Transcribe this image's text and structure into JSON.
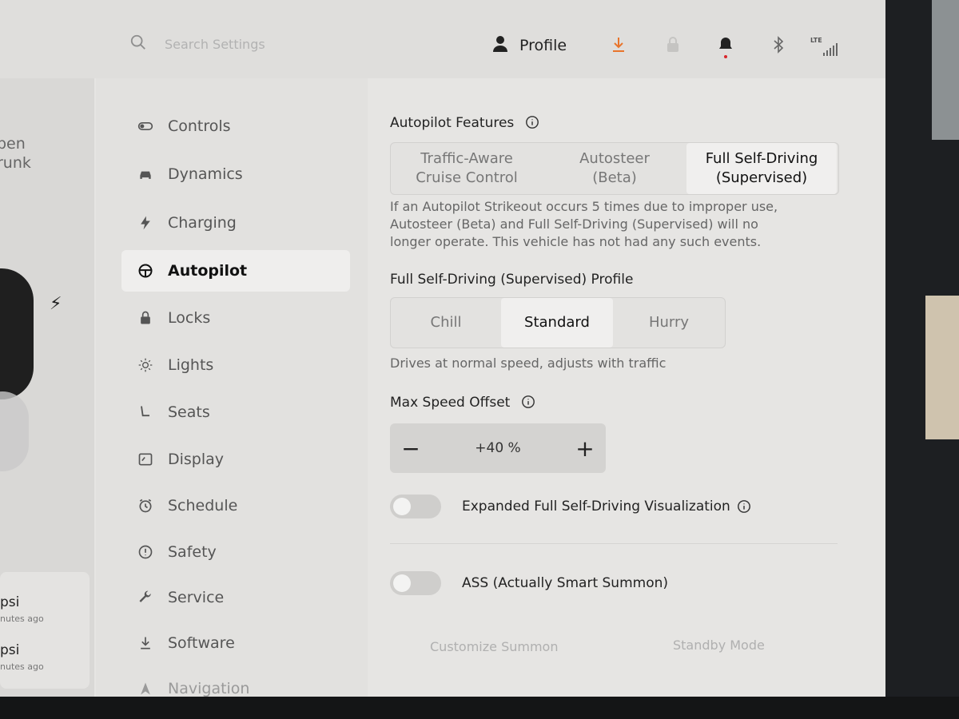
{
  "search": {
    "placeholder": "Search Settings"
  },
  "header": {
    "profile_label": "Profile",
    "signal_label": "LTE",
    "icons": [
      "search-icon",
      "profile-icon",
      "download-icon",
      "lock-icon",
      "bell-icon",
      "bluetooth-icon",
      "signal-icon"
    ],
    "accent": "#e8742b",
    "alert_dot": "#d9262b"
  },
  "left_panel": {
    "trunk_line1": "pen",
    "trunk_line2": "runk",
    "tire1_psi": "psi",
    "tire1_age": "nutes ago",
    "tire2_psi": "psi",
    "tire2_age": "nutes ago"
  },
  "sidebar": {
    "items": [
      {
        "label": "Controls",
        "icon": "toggle-icon"
      },
      {
        "label": "Dynamics",
        "icon": "car-icon"
      },
      {
        "label": "Charging",
        "icon": "bolt-icon"
      },
      {
        "label": "Autopilot",
        "icon": "steering-wheel-icon",
        "active": true
      },
      {
        "label": "Locks",
        "icon": "lock-icon"
      },
      {
        "label": "Lights",
        "icon": "sun-icon"
      },
      {
        "label": "Seats",
        "icon": "seat-icon"
      },
      {
        "label": "Display",
        "icon": "display-icon"
      },
      {
        "label": "Schedule",
        "icon": "alarm-clock-icon"
      },
      {
        "label": "Safety",
        "icon": "exclamation-circle-icon"
      },
      {
        "label": "Service",
        "icon": "wrench-icon"
      },
      {
        "label": "Software",
        "icon": "download-icon"
      },
      {
        "label": "Navigation",
        "icon": "navigation-arrow-icon"
      }
    ]
  },
  "autopilot": {
    "features_title": "Autopilot Features",
    "features_options": [
      {
        "line1": "Traffic-Aware",
        "line2": "Cruise Control"
      },
      {
        "line1": "Autosteer",
        "line2": "(Beta)"
      },
      {
        "line1": "Full Self-Driving",
        "line2": "(Supervised)",
        "selected": true
      }
    ],
    "strikeout_line1": "If an Autopilot Strikeout occurs 5 times due to improper use,",
    "strikeout_line2": "Autosteer (Beta) and Full Self-Driving (Supervised) will no",
    "strikeout_line3": "longer operate. This vehicle has not had any such events.",
    "profile_title": "Full Self-Driving (Supervised) Profile",
    "profile_options": [
      {
        "label": "Chill"
      },
      {
        "label": "Standard",
        "selected": true
      },
      {
        "label": "Hurry"
      }
    ],
    "profile_description": "Drives at normal speed, adjusts with traffic",
    "speed_offset_title": "Max Speed Offset",
    "speed_offset_value": "+40 %",
    "minus_label": "−",
    "plus_label": "+",
    "toggle1_label": "Expanded Full Self-Driving Visualization",
    "toggle1_on": false,
    "toggle2_label": "ASS (Actually Smart Summon)",
    "toggle2_on": false,
    "customize_summon": "Customize Summon",
    "standby_mode": "Standby Mode"
  }
}
